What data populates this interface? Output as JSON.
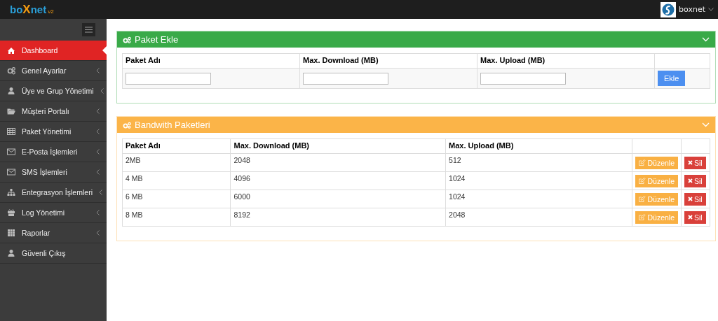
{
  "topbar": {
    "logo": {
      "parts": [
        "bo",
        "X",
        "net"
      ],
      "version": "v2"
    },
    "user": {
      "name": "boxnet"
    }
  },
  "sidebar": {
    "items": [
      {
        "label": "Dashboard",
        "kind": "home",
        "selected": true,
        "caret": false
      },
      {
        "label": "Genel Ayarlar",
        "kind": "gears",
        "selected": false,
        "caret": true
      },
      {
        "label": "Üye ve Grup Yönetimi",
        "kind": "user",
        "selected": false,
        "caret": true
      },
      {
        "label": "Müşteri Portalı",
        "kind": "folder",
        "selected": false,
        "caret": true
      },
      {
        "label": "Paket Yönetimi",
        "kind": "table",
        "selected": false,
        "caret": true
      },
      {
        "label": "E-Posta İşlemleri",
        "kind": "envelope",
        "selected": false,
        "caret": true
      },
      {
        "label": "SMS İşlemleri",
        "kind": "envelope",
        "selected": false,
        "caret": true
      },
      {
        "label": "Entegrasyon İşlemleri",
        "kind": "sitemap",
        "selected": false,
        "caret": true
      },
      {
        "label": "Log Yönetimi",
        "kind": "gift",
        "selected": false,
        "caret": true
      },
      {
        "label": "Raporlar",
        "kind": "grid",
        "selected": false,
        "caret": true
      },
      {
        "label": "Güvenli Çıkış",
        "kind": "user",
        "selected": false,
        "caret": false
      }
    ]
  },
  "add_panel": {
    "title": "Paket Ekle",
    "color": "#39aa48",
    "columns": [
      "Paket Adı",
      "Max. Download (MB)",
      "Max. Upload (MB)"
    ],
    "button": "Ekle"
  },
  "list_panel": {
    "title": "Bandwith Paketleri",
    "color": "#fbb448",
    "columns": [
      "Paket Adı",
      "Max. Download (MB)",
      "Max. Upload (MB)"
    ],
    "rows": [
      {
        "name": "2MB",
        "download": "2048",
        "upload": "512",
        "edit": "Düzenle",
        "delete": "Sil"
      },
      {
        "name": "4 MB",
        "download": "4096",
        "upload": "1024",
        "edit": "Düzenle",
        "delete": "Sil"
      },
      {
        "name": "6 MB",
        "download": "6000",
        "upload": "1024",
        "edit": "Düzenle",
        "delete": "Sil"
      },
      {
        "name": "8 MB",
        "download": "8192",
        "upload": "2048",
        "edit": "Düzenle",
        "delete": "Sil"
      }
    ]
  }
}
